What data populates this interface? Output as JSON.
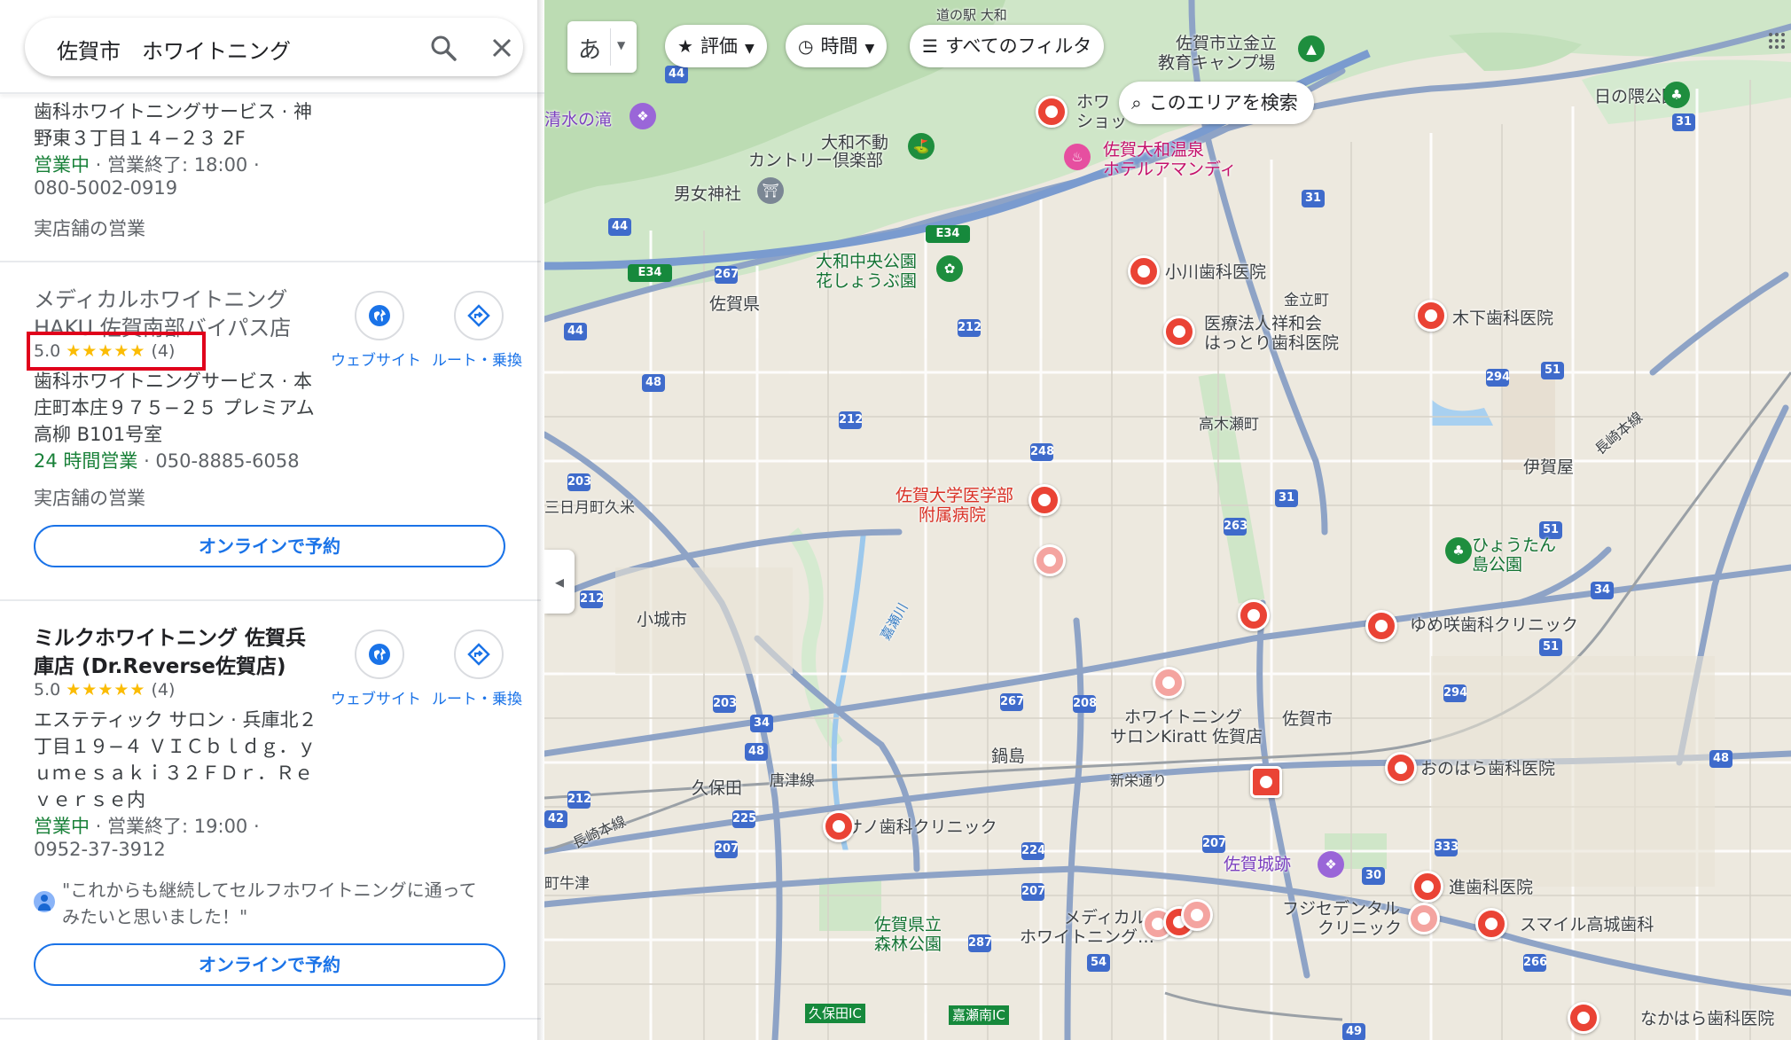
{
  "search": {
    "query": "佐賀市　ホワイトニング"
  },
  "results": [
    {
      "category_address": "歯科ホワイトニングサービス · 神",
      "address_cont": "野東３丁目１４−２３ 2F",
      "hours_status": "営業中",
      "hours_rest": " · 営業終了: 18:00 ·",
      "phone": "080-5002-0919",
      "service": "実店舗の営業"
    },
    {
      "name_line1": "メディカルホワイトニング",
      "name_line2": "HAKU 佐賀南部バイパス店",
      "rating": "5.0",
      "stars": "★★★★★",
      "reviews": "(4)",
      "category_address": "歯科ホワイトニングサービス · 本",
      "address_cont": "庄町本庄９７５−２５ プレミアム",
      "address_cont2": "高柳 B101号室",
      "hours_status": "24 時間営業",
      "hours_rest": " · 050-8885-6058",
      "service": "実店舗の営業",
      "website_label": "ウェブサイト",
      "route_label": "ルート・乗換",
      "book_label": "オンラインで予約"
    },
    {
      "name_line1": "ミルクホワイトニング 佐賀兵",
      "name_line2": "庫店 (Dr.Reverse佐賀店)",
      "rating": "5.0",
      "stars": "★★★★★",
      "reviews": "(4)",
      "category_address": "エステティック サロン · 兵庫北２",
      "address_cont": "丁目１９−４ ＶＩＣｂｌｄｇ．ｙ",
      "address_cont2": "ｕｍｅｓａｋｉ３２ＦＤｒ．Ｒｅ",
      "address_cont3": "ｖｅｒｓｅ内",
      "hours_status": "営業中",
      "hours_rest": " · 営業終了: 19:00 ·",
      "phone": "0952-37-3912",
      "review_line1": "\"これからも継続してセルフホワイトニングに通って",
      "review_line2": "みたいと思いました！\"",
      "website_label": "ウェブサイト",
      "route_label": "ルート・乗換",
      "book_label": "オンラインで予約"
    }
  ],
  "map_controls": {
    "lang": "あ",
    "chip_rating": "評価",
    "chip_hours": "時間",
    "chip_filters": "すべてのフィルタ",
    "area_search": "このエリアを検索"
  },
  "map_labels": {
    "michinoeki": "道の駅 大和",
    "camp1": "佐賀市立金立",
    "camp2": "教育キャンプ場",
    "hinokuma": "日の隈公園",
    "shimizu": "清水の滝",
    "yamato_fudo1": "大和不動",
    "yamato_fudo2": "カントリー倶楽部",
    "nyonyo": "男女神社",
    "onsen1": "佐賀大和温泉",
    "onsen2": "ホテルアマンディ",
    "howa1": "ホワ",
    "howa2": "ショッ",
    "park1": "大和中央公園",
    "park2": "花しょうぶ園",
    "saga_ken": "佐賀県",
    "ogawa": "小川歯科医院",
    "kinryu": "金立町",
    "hattori1": "医療法人祥和会",
    "hattori2": "はっとり歯科医院",
    "kinoshita": "木下歯科医院",
    "takakise": "高木瀬町",
    "igaya": "伊賀屋",
    "nagasaki_line": "長崎本線",
    "univ1": "佐賀大学医学部",
    "univ2": "附属病院",
    "mikazuki": "三日月町久米",
    "hyotan1": "ひょうたん",
    "hyotan2": "島公園",
    "ogi": "小城市",
    "kasegawa": "嘉瀬川",
    "yumesaki": "ゆめ咲歯科クリニック",
    "kiratt1": "ホワイトニング",
    "kiratt2": "サロンKiratt 佐賀店",
    "saga_city": "佐賀市",
    "nabeshima": "鍋島",
    "shineido": "新栄通り",
    "kubota": "久保田",
    "karatsu_line": "唐津線",
    "onohara": "おのはら歯科医院",
    "sano": "サノ歯科クリニック",
    "nagasaki_line2": "長崎本線",
    "saga_castle": "佐賀城跡",
    "susumu": "進歯科医院",
    "fuji1": "フジセデンタル",
    "fuji2": "クリニック",
    "smile": "スマイル高城歯科",
    "medical1": "メディカル",
    "medical2": "ホワイトニング…",
    "shinrin1": "佐賀県立",
    "shinrin2": "森林公園",
    "machitsu": "町牛津",
    "kubota_ic": "久保田IC",
    "kase_ic": "嘉瀬南IC",
    "nakahara": "なかはら歯科医院",
    "e34a": "E34",
    "e34b": "E34"
  },
  "route_numbers": [
    "44",
    "44",
    "44",
    "267",
    "212",
    "48",
    "212",
    "248",
    "203",
    "212",
    "203",
    "34",
    "48",
    "212",
    "225",
    "207",
    "267",
    "208",
    "224",
    "207",
    "287",
    "54",
    "49",
    "31",
    "31",
    "294",
    "51",
    "31",
    "263",
    "34",
    "51",
    "294",
    "48",
    "333",
    "30",
    "266",
    "51",
    "207",
    "42"
  ],
  "colors": {
    "accent": "#1a73e8",
    "open": "#188038",
    "star": "#fbbc04",
    "pin": "#ea4335",
    "highlight": "#e0001b"
  }
}
